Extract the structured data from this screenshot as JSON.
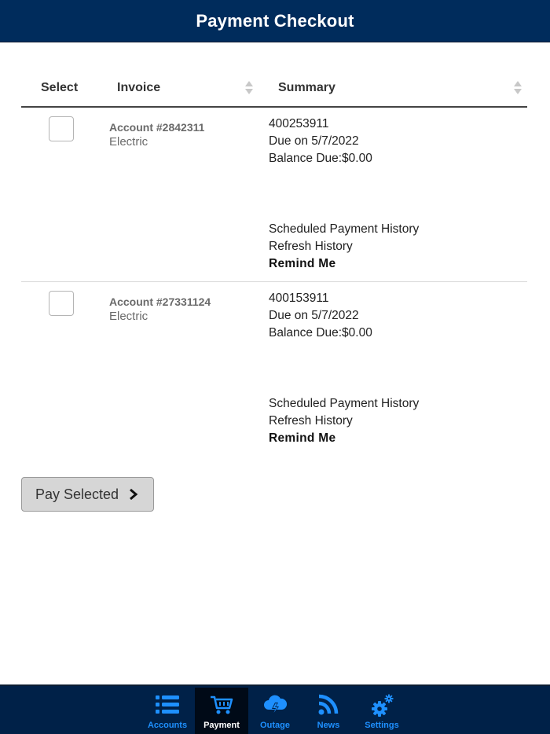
{
  "header": {
    "title": "Payment Checkout"
  },
  "table": {
    "columns": {
      "select": "Select",
      "invoice": "Invoice",
      "summary": "Summary"
    },
    "rows": [
      {
        "account": "Account #2842311",
        "type": "Electric",
        "invoice_number": "400253911",
        "due": "Due on 5/7/2022",
        "balance": "Balance Due:$0.00",
        "links": {
          "scheduled": "Scheduled Payment History",
          "refresh": "Refresh History",
          "remind": "Remind Me"
        },
        "checked": false
      },
      {
        "account": "Account #27331124",
        "type": "Electric",
        "invoice_number": "400153911",
        "due": "Due on 5/7/2022",
        "balance": "Balance Due:$0.00",
        "links": {
          "scheduled": "Scheduled Payment History",
          "refresh": "Refresh History",
          "remind": "Remind Me"
        },
        "checked": false
      }
    ]
  },
  "pay_button": {
    "label": "Pay Selected",
    "icon": "chevron-right-icon"
  },
  "tabbar": {
    "active": "Payment",
    "items": [
      {
        "label": "Accounts",
        "icon": "list-icon"
      },
      {
        "label": "Payment",
        "icon": "cart-icon"
      },
      {
        "label": "Outage",
        "icon": "storm-cloud-icon"
      },
      {
        "label": "News",
        "icon": "rss-icon"
      },
      {
        "label": "Settings",
        "icon": "gears-icon"
      }
    ]
  },
  "colors": {
    "header_bg": "#002c5c",
    "tabbar_bg": "#002148",
    "tab_active_bg": "#000a17",
    "tab_accent": "#1e90ff",
    "button_bg": "#d6d6d6"
  }
}
